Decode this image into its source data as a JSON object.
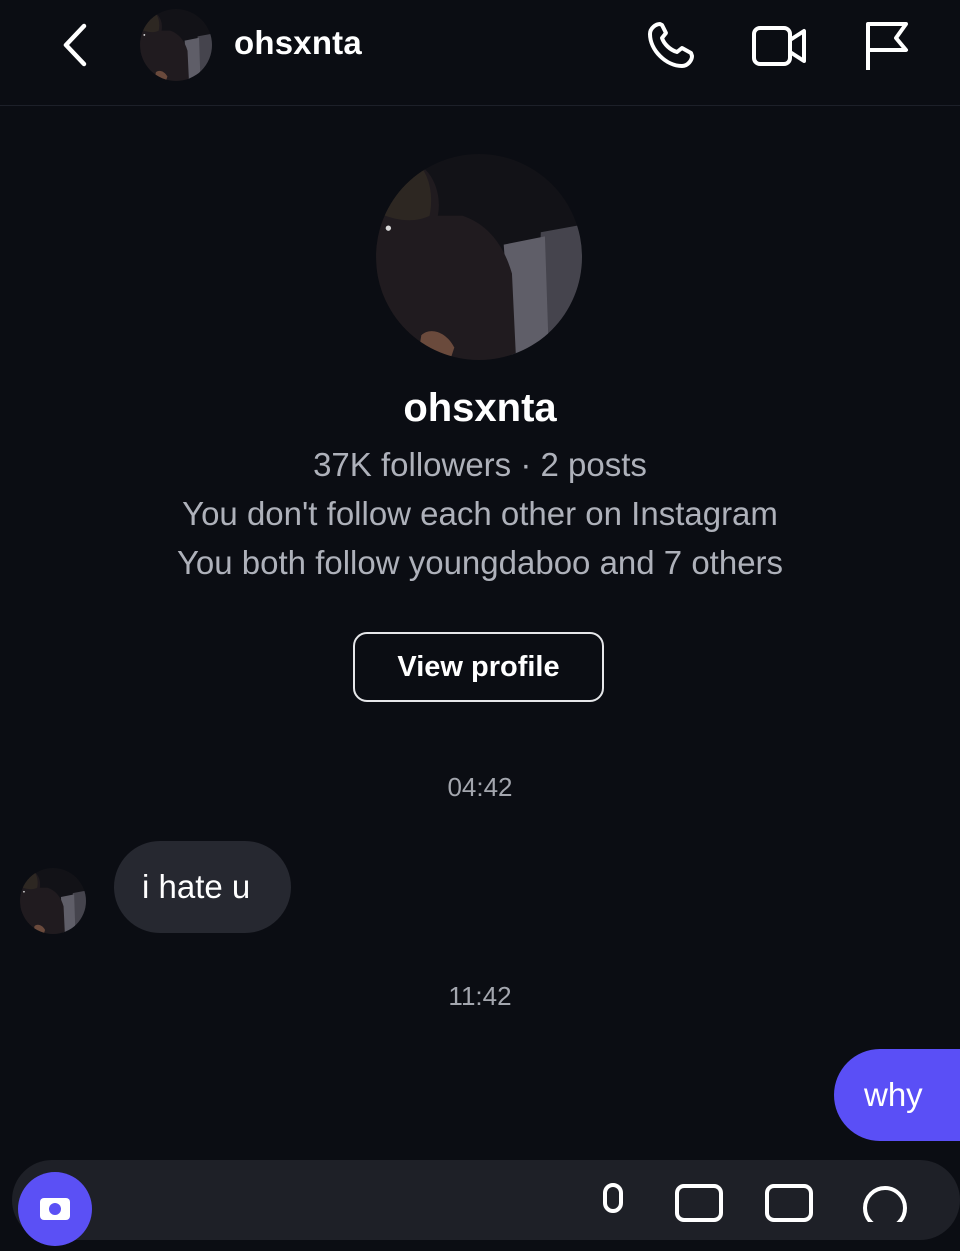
{
  "header": {
    "username": "ohsxnta",
    "icons": [
      "back-icon",
      "phone-icon",
      "video-icon",
      "flag-icon"
    ]
  },
  "profile": {
    "username": "ohsxnta",
    "stats": "37K followers · 2 posts",
    "follow_status": "You don't follow each other on Instagram",
    "mutuals": "You both follow youngdaboo and 7 others",
    "view_profile_label": "View profile"
  },
  "messages": [
    {
      "time": "04:42",
      "direction": "incoming",
      "text": "i hate u"
    },
    {
      "time": "11:42",
      "direction": "outgoing",
      "text": "why"
    }
  ],
  "colors": {
    "background": "#0b0d13",
    "incoming_bubble": "#262830",
    "outgoing_bubble": "#5a4ff6",
    "secondary_text": "#aeb1ba"
  },
  "composer": {
    "icons": [
      "camera-icon",
      "mic-icon",
      "image-icon",
      "sticker-icon",
      "emoji-icon"
    ]
  }
}
